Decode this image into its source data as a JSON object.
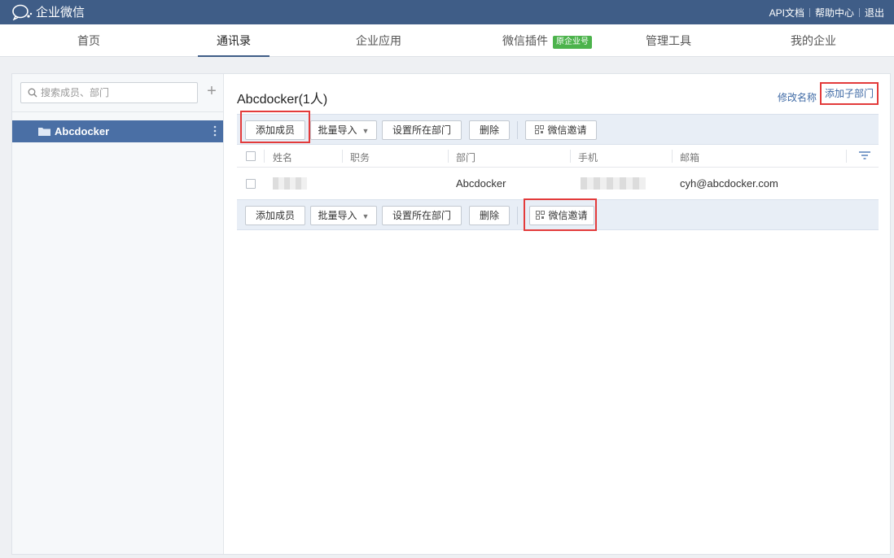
{
  "app": {
    "title": "企业微信"
  },
  "top_links": [
    {
      "label": "API文档"
    },
    {
      "label": "帮助中心"
    },
    {
      "label": "退出"
    }
  ],
  "nav": {
    "items": [
      {
        "label": "首页"
      },
      {
        "label": "通讯录",
        "active": true
      },
      {
        "label": "企业应用"
      },
      {
        "label": "微信插件",
        "badge": "原企业号"
      },
      {
        "label": "管理工具"
      },
      {
        "label": "我的企业"
      }
    ]
  },
  "sidebar": {
    "search": {
      "placeholder": "搜索成员、部门",
      "value": ""
    },
    "add_symbol": "+",
    "departments": [
      {
        "label": "Abcdocker",
        "selected": true
      }
    ],
    "more_symbol": "⋮"
  },
  "main": {
    "title": "Abcdocker(1人)",
    "rename_label": "修改名称",
    "add_sub_label": "添加子部门",
    "toolbar": {
      "add_member": "添加成员",
      "batch_import": "批量导入",
      "batch_caret": "▼",
      "set_dept": "设置所在部门",
      "delete": "删除",
      "wechat_invite": "微信邀请"
    },
    "table": {
      "headers": {
        "name": "姓名",
        "position": "职务",
        "department": "部门",
        "mobile": "手机",
        "email": "邮箱"
      },
      "rows": [
        {
          "name": "",
          "position": "",
          "department": "Abcdocker",
          "mobile": "",
          "email": "cyh@abcdocker.com"
        }
      ]
    }
  },
  "colors": {
    "topbar": "#3f5d87",
    "selected_dept": "#4a6fa5",
    "badge": "#4cb34c",
    "highlight": "#e33b3b",
    "link": "#3f6aa5"
  }
}
